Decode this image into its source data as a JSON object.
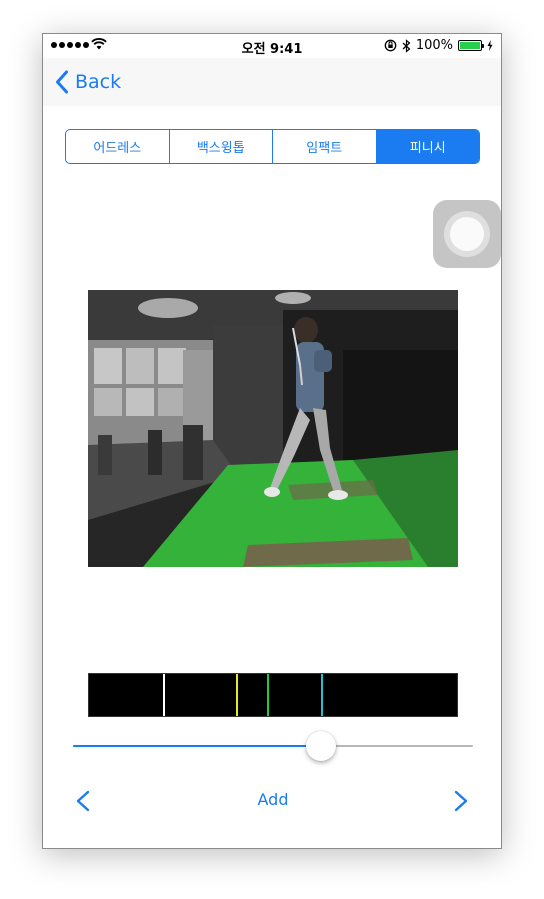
{
  "status_bar": {
    "time": "오전 9:41",
    "battery_text": "100%",
    "battery_level": 1.0,
    "battery_color": "#27d04b"
  },
  "nav": {
    "back_label": "Back",
    "back_icon": "chevron-left-icon"
  },
  "segments": [
    {
      "label": "어드레스",
      "selected": false
    },
    {
      "label": "백스윙톱",
      "selected": false
    },
    {
      "label": "임팩트",
      "selected": false
    },
    {
      "label": "피니시",
      "selected": true
    }
  ],
  "timeline": {
    "background": "#000000",
    "markers": [
      {
        "position": 0.2,
        "color": "#ffffff"
      },
      {
        "position": 0.4,
        "color": "#e8e82a"
      },
      {
        "position": 0.485,
        "color": "#22c840"
      },
      {
        "position": 0.63,
        "color": "#1ec0d8"
      }
    ]
  },
  "slider": {
    "value": 0.62,
    "accent_color": "#1a7cf0"
  },
  "controls": {
    "prev_icon": "chevron-left-icon",
    "add_label": "Add",
    "next_icon": "chevron-right-icon"
  },
  "accent_color": "#1a7cf0"
}
